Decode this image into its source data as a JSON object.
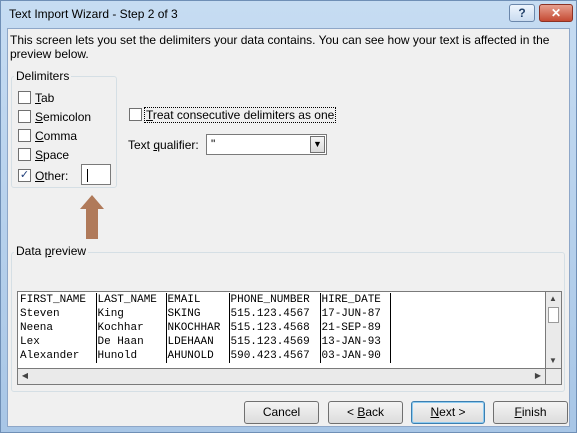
{
  "window": {
    "title": "Text Import Wizard - Step 2 of 3",
    "help_label": "?",
    "close_label": "✕"
  },
  "description": "This screen lets you set the delimiters your data contains.  You can see how your text is affected in the preview below.",
  "delimiters": {
    "group_title": "Delimiters",
    "items": [
      {
        "label": "Tab",
        "hotkey": "T",
        "rest": "ab",
        "checked": false
      },
      {
        "label": "Semicolon",
        "hotkey": "S",
        "rest": "emicolon",
        "checked": false
      },
      {
        "label": "Comma",
        "hotkey": "C",
        "rest": "omma",
        "checked": false
      },
      {
        "label": "Space",
        "hotkey": "S",
        "rest": "pace",
        "checked": false
      },
      {
        "label": "Other:",
        "hotkey": "O",
        "rest": "ther:",
        "checked": true
      }
    ],
    "other_value": ""
  },
  "consecutive": {
    "label": "Treat consecutive delimiters as one",
    "hotkey": "T",
    "rest": "reat consecutive delimiters as one",
    "checked": false
  },
  "qualifier": {
    "label_before": "Text ",
    "hotkey": "q",
    "label_after": "ualifier:",
    "value": "\"",
    "arrow_icon": "▼"
  },
  "annotation": {
    "arrow_color": "#b07a5a"
  },
  "preview": {
    "group_title_before": "Data ",
    "hotkey": "p",
    "group_title_after": "review",
    "rows": [
      [
        "FIRST_NAME",
        "LAST_NAME",
        "EMAIL",
        "PHONE_NUMBER",
        "HIRE_DATE"
      ],
      [
        "Steven",
        "King",
        "SKING",
        "515.123.4567",
        "17-JUN-87"
      ],
      [
        "Neena",
        "Kochhar",
        "NKOCHHAR",
        "515.123.4568",
        "21-SEP-89"
      ],
      [
        "Lex",
        "De Haan",
        "LDEHAAN",
        "515.123.4569",
        "13-JAN-93"
      ],
      [
        "Alexander",
        "Hunold",
        "AHUNOLD",
        "590.423.4567",
        "03-JAN-90"
      ]
    ],
    "scroll_up_icon": "▲",
    "scroll_down_icon": "▼",
    "scroll_left_icon": "◀",
    "scroll_right_icon": "▶"
  },
  "buttons": {
    "cancel": {
      "label": "Cancel"
    },
    "back": {
      "prefix": "< ",
      "hotkey": "B",
      "rest": "ack"
    },
    "next": {
      "hotkey": "N",
      "rest": "ext >"
    },
    "finish": {
      "hotkey": "F",
      "rest": "inish"
    }
  }
}
